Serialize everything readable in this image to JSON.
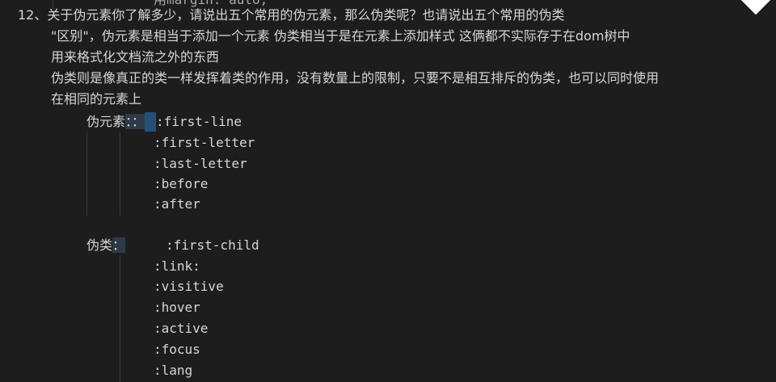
{
  "top_partial": "用margin: auto;",
  "q_number": "12、",
  "lines": [
    "关于伪元素你了解多少，请说出五个常用的伪元素，那么伪类呢？也请说出五个常用的伪类",
    "\"区别\"，伪元素是相当于添加一个元素 伪类相当于是在元素上添加样式 这俩都不实际存于在dom树中",
    "用来格式化文档流之外的东西",
    "伪类则是像真正的类一样发挥着类的作用，没有数量上的限制，只要不是相互排斥的伪类，也可以同时使用",
    "在相同的元素上"
  ],
  "pseudo_elements": {
    "label": "伪元素",
    "sep": "：：",
    "items": [
      ":first-line",
      ":first-letter",
      ":last-letter",
      ":before",
      ":after"
    ]
  },
  "pseudo_classes": {
    "label": "伪类",
    "sep": "：",
    "items": [
      ":first-child",
      ":link:",
      ":visitive",
      ":hover",
      ":active",
      ":focus",
      ":lang"
    ]
  }
}
